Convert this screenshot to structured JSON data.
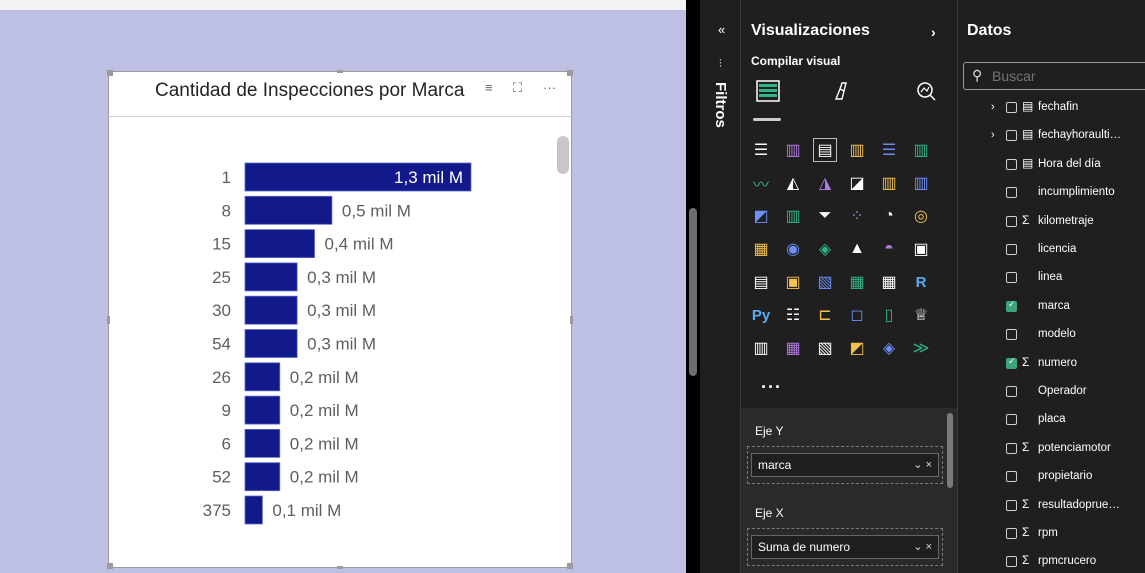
{
  "visual": {
    "title": "Cantidad de Inspecciones por Marca",
    "header_icons": {
      "filter": "≡",
      "focus": "⛶",
      "more": "···"
    }
  },
  "chart_data": {
    "type": "bar",
    "orientation": "horizontal",
    "title": "Cantidad de Inspecciones por Marca",
    "categories": [
      "1",
      "8",
      "15",
      "25",
      "30",
      "54",
      "26",
      "9",
      "6",
      "52",
      "375"
    ],
    "values": [
      1300,
      500,
      400,
      300,
      300,
      300,
      200,
      200,
      200,
      200,
      100
    ],
    "value_units": "mil M",
    "data_labels": [
      "1,3 mil M",
      "0,5 mil M",
      "0,4 mil M",
      "0,3 mil M",
      "0,3 mil M",
      "0,3 mil M",
      "0,2 mil M",
      "0,2 mil M",
      "0,2 mil M",
      "0,2 mil M",
      "0,1 mil M"
    ],
    "bar_color": "#12198a",
    "grid": false,
    "legend": "none"
  },
  "filters": {
    "label": "Filtros",
    "collapse_icon": "«"
  },
  "visualizations": {
    "title": "Visualizaciones",
    "expand_icon": "›",
    "build_label": "Compilar visual",
    "more_label": "···",
    "gallery": [
      "stacked-bar-chart-icon",
      "stacked-column-chart-icon",
      "clustered-bar-chart-icon",
      "clustered-column-chart-icon",
      "100-stacked-bar-chart-icon",
      "100-stacked-column-chart-icon",
      "line-chart-icon",
      "area-chart-icon",
      "stacked-area-chart-icon",
      "100-stacked-area-chart-icon",
      "line-and-stacked-column-chart-icon",
      "line-and-clustered-column-chart-icon",
      "ribbon-chart-icon",
      "waterfall-chart-icon",
      "funnel-chart-icon",
      "scatter-chart-icon",
      "pie-chart-icon",
      "donut-chart-icon",
      "treemap-icon",
      "map-icon",
      "filled-map-icon",
      "azure-map-icon",
      "gauge-icon",
      "card-icon",
      "multi-row-card-icon",
      "kpi-icon",
      "slicer-icon",
      "table-icon",
      "matrix-icon",
      "r-visual-icon",
      "python-visual-icon",
      "key-influencers-icon",
      "decomposition-tree-icon",
      "qa-icon",
      "smart-narrative-icon",
      "metrics-icon",
      "paginated-report-icon",
      "power-apps-icon",
      "power-automate-icon",
      "custom-visual-icon",
      "diamond-visual-icon",
      "chevron-visual-icon"
    ],
    "glyphs": [
      "☰",
      "▥",
      "▤",
      "▥",
      "☰",
      "▥",
      "〰",
      "◭",
      "◮",
      "◪",
      "▥",
      "▥",
      "◩",
      "▥",
      "⏷",
      "⁘",
      "◔",
      "◎",
      "▦",
      "◉",
      "◈",
      "▲",
      "◓",
      "▣",
      "▤",
      "▣",
      "▧",
      "▦",
      "▦",
      "R",
      "Py",
      "☷",
      "⊏",
      "◻",
      "▯",
      "♕",
      "▥",
      "▦",
      "▧",
      "◩",
      "◈",
      "≫"
    ],
    "eje_y_label": "Eje Y",
    "eje_y_field": "marca",
    "eje_x_label": "Eje X",
    "eje_x_field": "Suma de numero",
    "pill_controls": "⌄ ×"
  },
  "datos": {
    "title": "Datos",
    "search_placeholder": "Buscar",
    "fields": [
      {
        "name": "fechafin",
        "chevron": "›",
        "icon": "▤",
        "checked": false
      },
      {
        "name": "fechayhoraulti…",
        "chevron": "›",
        "icon": "▤",
        "checked": false
      },
      {
        "name": "Hora del día",
        "chevron": "",
        "icon": "▤",
        "checked": false
      },
      {
        "name": "incumplimiento",
        "chevron": "",
        "icon": "",
        "checked": false
      },
      {
        "name": "kilometraje",
        "chevron": "",
        "icon": "Σ",
        "checked": false
      },
      {
        "name": "licencia",
        "chevron": "",
        "icon": "",
        "checked": false
      },
      {
        "name": "linea",
        "chevron": "",
        "icon": "",
        "checked": false
      },
      {
        "name": "marca",
        "chevron": "",
        "icon": "",
        "checked": true
      },
      {
        "name": "modelo",
        "chevron": "",
        "icon": "",
        "checked": false
      },
      {
        "name": "numero",
        "chevron": "",
        "icon": "Σ",
        "checked": true
      },
      {
        "name": "Operador",
        "chevron": "",
        "icon": "",
        "checked": false
      },
      {
        "name": "placa",
        "chevron": "",
        "icon": "",
        "checked": false
      },
      {
        "name": "potenciamotor",
        "chevron": "",
        "icon": "Σ",
        "checked": false
      },
      {
        "name": "propietario",
        "chevron": "",
        "icon": "",
        "checked": false
      },
      {
        "name": "resultadoprue…",
        "chevron": "",
        "icon": "Σ",
        "checked": false
      },
      {
        "name": "rpm",
        "chevron": "",
        "icon": "Σ",
        "checked": false
      },
      {
        "name": "rpmcrucero",
        "chevron": "",
        "icon": "Σ",
        "checked": false
      }
    ]
  },
  "colors": {
    "canvas_bg": "#bec0e3",
    "pane_bg": "#1f1f1f",
    "accent_check": "#3aa57a"
  }
}
